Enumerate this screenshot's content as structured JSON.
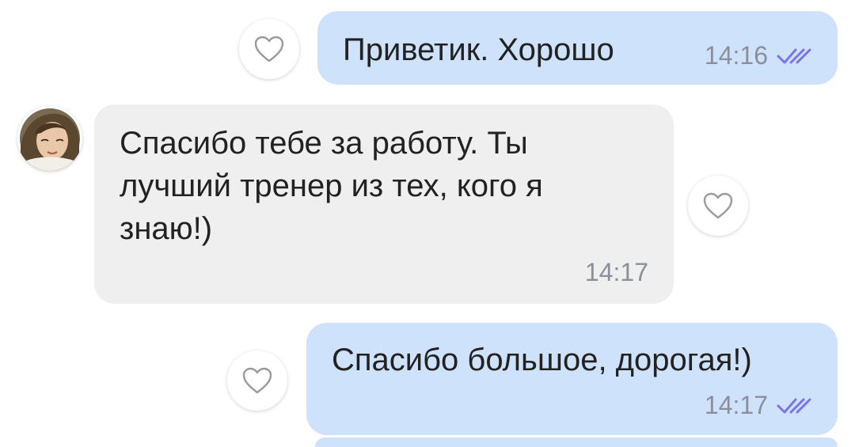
{
  "messages": [
    {
      "direction": "outgoing",
      "text": "Приветик. Хорошо",
      "time": "14:16",
      "status_icon": "double-check-icon",
      "like_icon": "heart-outline-icon"
    },
    {
      "direction": "incoming",
      "text": "Спасибо тебе за работу. Ты\nлучший тренер из тех, кого я\nзнаю!)",
      "time": "14:17",
      "avatar": "contact-avatar",
      "like_icon": "heart-outline-icon"
    },
    {
      "direction": "outgoing",
      "text": "Спасибо большое, дорогая!)",
      "time": "14:17",
      "status_icon": "double-check-icon",
      "like_icon": "heart-outline-icon"
    }
  ],
  "colors": {
    "outgoing_bubble": "#cfe2fb",
    "incoming_bubble": "#efefef",
    "read_check": "#7b74e8",
    "timestamp": "#8a8f99"
  }
}
